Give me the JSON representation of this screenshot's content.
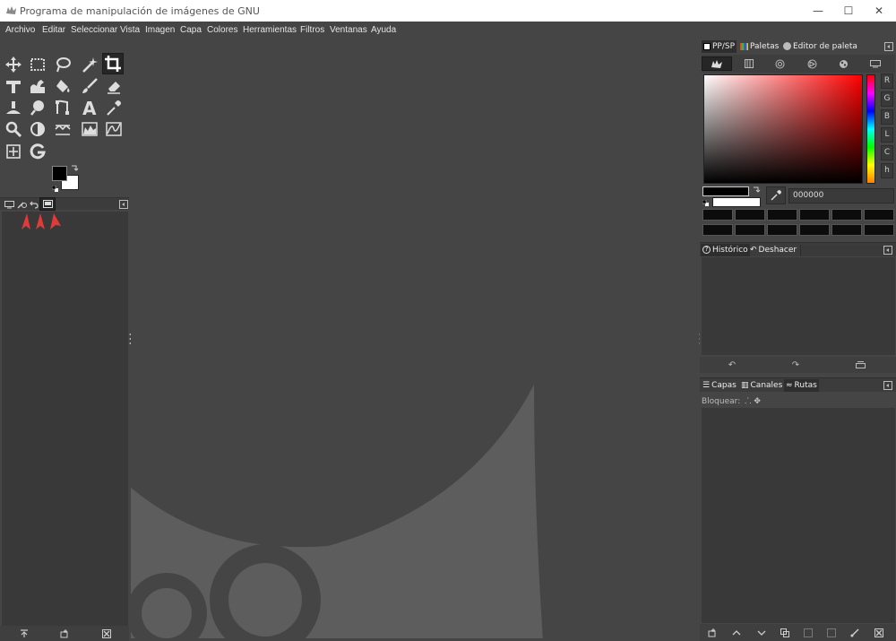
{
  "window": {
    "title": "Programa de manipulación de imágenes de GNU",
    "minimize": "—",
    "maximize": "☐",
    "close": "✕"
  },
  "menu": [
    "Archivo",
    "Editar",
    "Seleccionar",
    "Vista",
    "Imagen",
    "Capa",
    "Colores",
    "Herramientas",
    "Filtros",
    "Ventanas",
    "Ayuda"
  ],
  "colors": {
    "titlebar": "#ffffff",
    "ui_bg": "#454545",
    "panel_dark": "#393939",
    "wilber": "#5d5d5d",
    "arrow_red": "#e03a3a",
    "fg_color": "#000000",
    "bg_color": "#ffffff"
  },
  "right_dock": {
    "top_tabs": [
      "PP/SP",
      "Paletas",
      "Editor de paleta"
    ],
    "selector_icons": [
      "wilber-selector-icon",
      "scales-icon",
      "wheel-icon",
      "triangle-icon",
      "watercolor-icon",
      "cmyk-icon"
    ],
    "channels": [
      "R",
      "G",
      "B",
      "L",
      "C",
      "h"
    ],
    "hex_value": "000000",
    "history_tabs": [
      "Histórico",
      "Deshacer"
    ],
    "layers_tabs": [
      "Capas",
      "Canales",
      "Rutas"
    ],
    "lock_label": "Bloquear:"
  }
}
